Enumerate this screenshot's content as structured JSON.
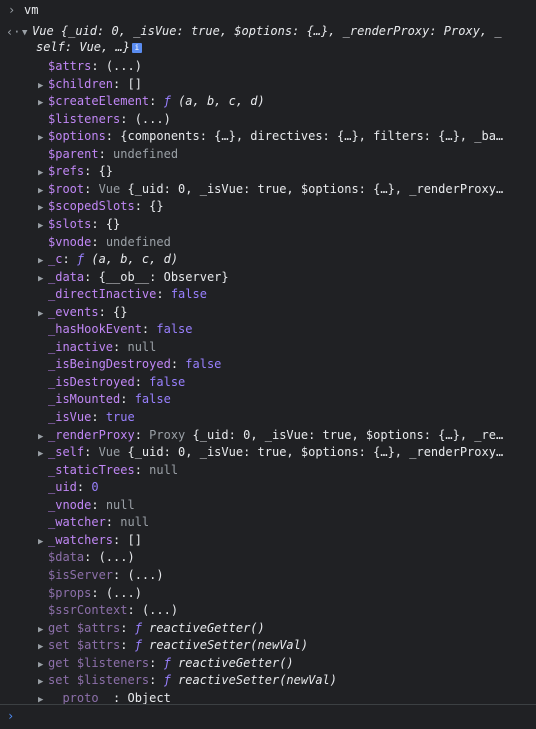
{
  "input_command": "vm",
  "summary": {
    "line1": "Vue {_uid: 0, _isVue: true, $options: {…}, _renderProxy: Proxy, _",
    "line2": "self: Vue, …}"
  },
  "rows": [
    {
      "name": "$attrs",
      "value": "(...)",
      "expandable": false,
      "style": "accessor"
    },
    {
      "name": "$children",
      "value": "[]",
      "expandable": true,
      "style": "plain"
    },
    {
      "name": "$createElement",
      "value": "ƒ (a, b, c, d)",
      "expandable": true,
      "style": "function"
    },
    {
      "name": "$listeners",
      "value": "(...)",
      "expandable": false,
      "style": "accessor"
    },
    {
      "name": "$options",
      "value": "{components: {…}, directives: {…}, filters: {…}, _ba…",
      "expandable": true,
      "style": "plain"
    },
    {
      "name": "$parent",
      "value": "undefined",
      "expandable": false,
      "style": "null"
    },
    {
      "name": "$refs",
      "value": "{}",
      "expandable": true,
      "style": "plain"
    },
    {
      "name": "$root",
      "value": "Vue {_uid: 0, _isVue: true, $options: {…}, _renderProxy…",
      "expandable": true,
      "style": "object"
    },
    {
      "name": "$scopedSlots",
      "value": "{}",
      "expandable": true,
      "style": "plain"
    },
    {
      "name": "$slots",
      "value": "{}",
      "expandable": true,
      "style": "plain"
    },
    {
      "name": "$vnode",
      "value": "undefined",
      "expandable": false,
      "style": "null"
    },
    {
      "name": "_c",
      "value": "ƒ (a, b, c, d)",
      "expandable": true,
      "style": "function"
    },
    {
      "name": "_data",
      "value": "{__ob__: Observer}",
      "expandable": true,
      "style": "plain"
    },
    {
      "name": "_directInactive",
      "value": "false",
      "expandable": false,
      "style": "bool"
    },
    {
      "name": "_events",
      "value": "{}",
      "expandable": true,
      "style": "plain"
    },
    {
      "name": "_hasHookEvent",
      "value": "false",
      "expandable": false,
      "style": "bool"
    },
    {
      "name": "_inactive",
      "value": "null",
      "expandable": false,
      "style": "null"
    },
    {
      "name": "_isBeingDestroyed",
      "value": "false",
      "expandable": false,
      "style": "bool"
    },
    {
      "name": "_isDestroyed",
      "value": "false",
      "expandable": false,
      "style": "bool"
    },
    {
      "name": "_isMounted",
      "value": "false",
      "expandable": false,
      "style": "bool"
    },
    {
      "name": "_isVue",
      "value": "true",
      "expandable": false,
      "style": "bool"
    },
    {
      "name": "_renderProxy",
      "value": "Proxy {_uid: 0, _isVue: true, $options: {…}, _re…",
      "expandable": true,
      "style": "object"
    },
    {
      "name": "_self",
      "value": "Vue {_uid: 0, _isVue: true, $options: {…}, _renderProxy…",
      "expandable": true,
      "style": "object"
    },
    {
      "name": "_staticTrees",
      "value": "null",
      "expandable": false,
      "style": "null"
    },
    {
      "name": "_uid",
      "value": "0",
      "expandable": false,
      "style": "num"
    },
    {
      "name": "_vnode",
      "value": "null",
      "expandable": false,
      "style": "null"
    },
    {
      "name": "_watcher",
      "value": "null",
      "expandable": false,
      "style": "null"
    },
    {
      "name": "_watchers",
      "value": "[]",
      "expandable": true,
      "style": "plain"
    },
    {
      "name": "$data",
      "value": "(...)",
      "expandable": false,
      "style": "accessor-dim"
    },
    {
      "name": "$isServer",
      "value": "(...)",
      "expandable": false,
      "style": "accessor-dim"
    },
    {
      "name": "$props",
      "value": "(...)",
      "expandable": false,
      "style": "accessor-dim"
    },
    {
      "name": "$ssrContext",
      "value": "(...)",
      "expandable": false,
      "style": "accessor-dim"
    },
    {
      "name": "get $attrs",
      "value": "ƒ reactiveGetter()",
      "expandable": true,
      "style": "getter"
    },
    {
      "name": "set $attrs",
      "value": "ƒ reactiveSetter(newVal)",
      "expandable": true,
      "style": "getter"
    },
    {
      "name": "get $listeners",
      "value": "ƒ reactiveGetter()",
      "expandable": true,
      "style": "getter"
    },
    {
      "name": "set $listeners",
      "value": "ƒ reactiveSetter(newVal)",
      "expandable": true,
      "style": "getter"
    },
    {
      "name": "__proto__",
      "value": "Object",
      "expandable": true,
      "style": "proto"
    }
  ],
  "colors": {
    "background": "#202124",
    "property": "#c087f5",
    "keyword": "#9980ff",
    "muted": "#9aa0a6",
    "caret": "#4e8df6"
  }
}
